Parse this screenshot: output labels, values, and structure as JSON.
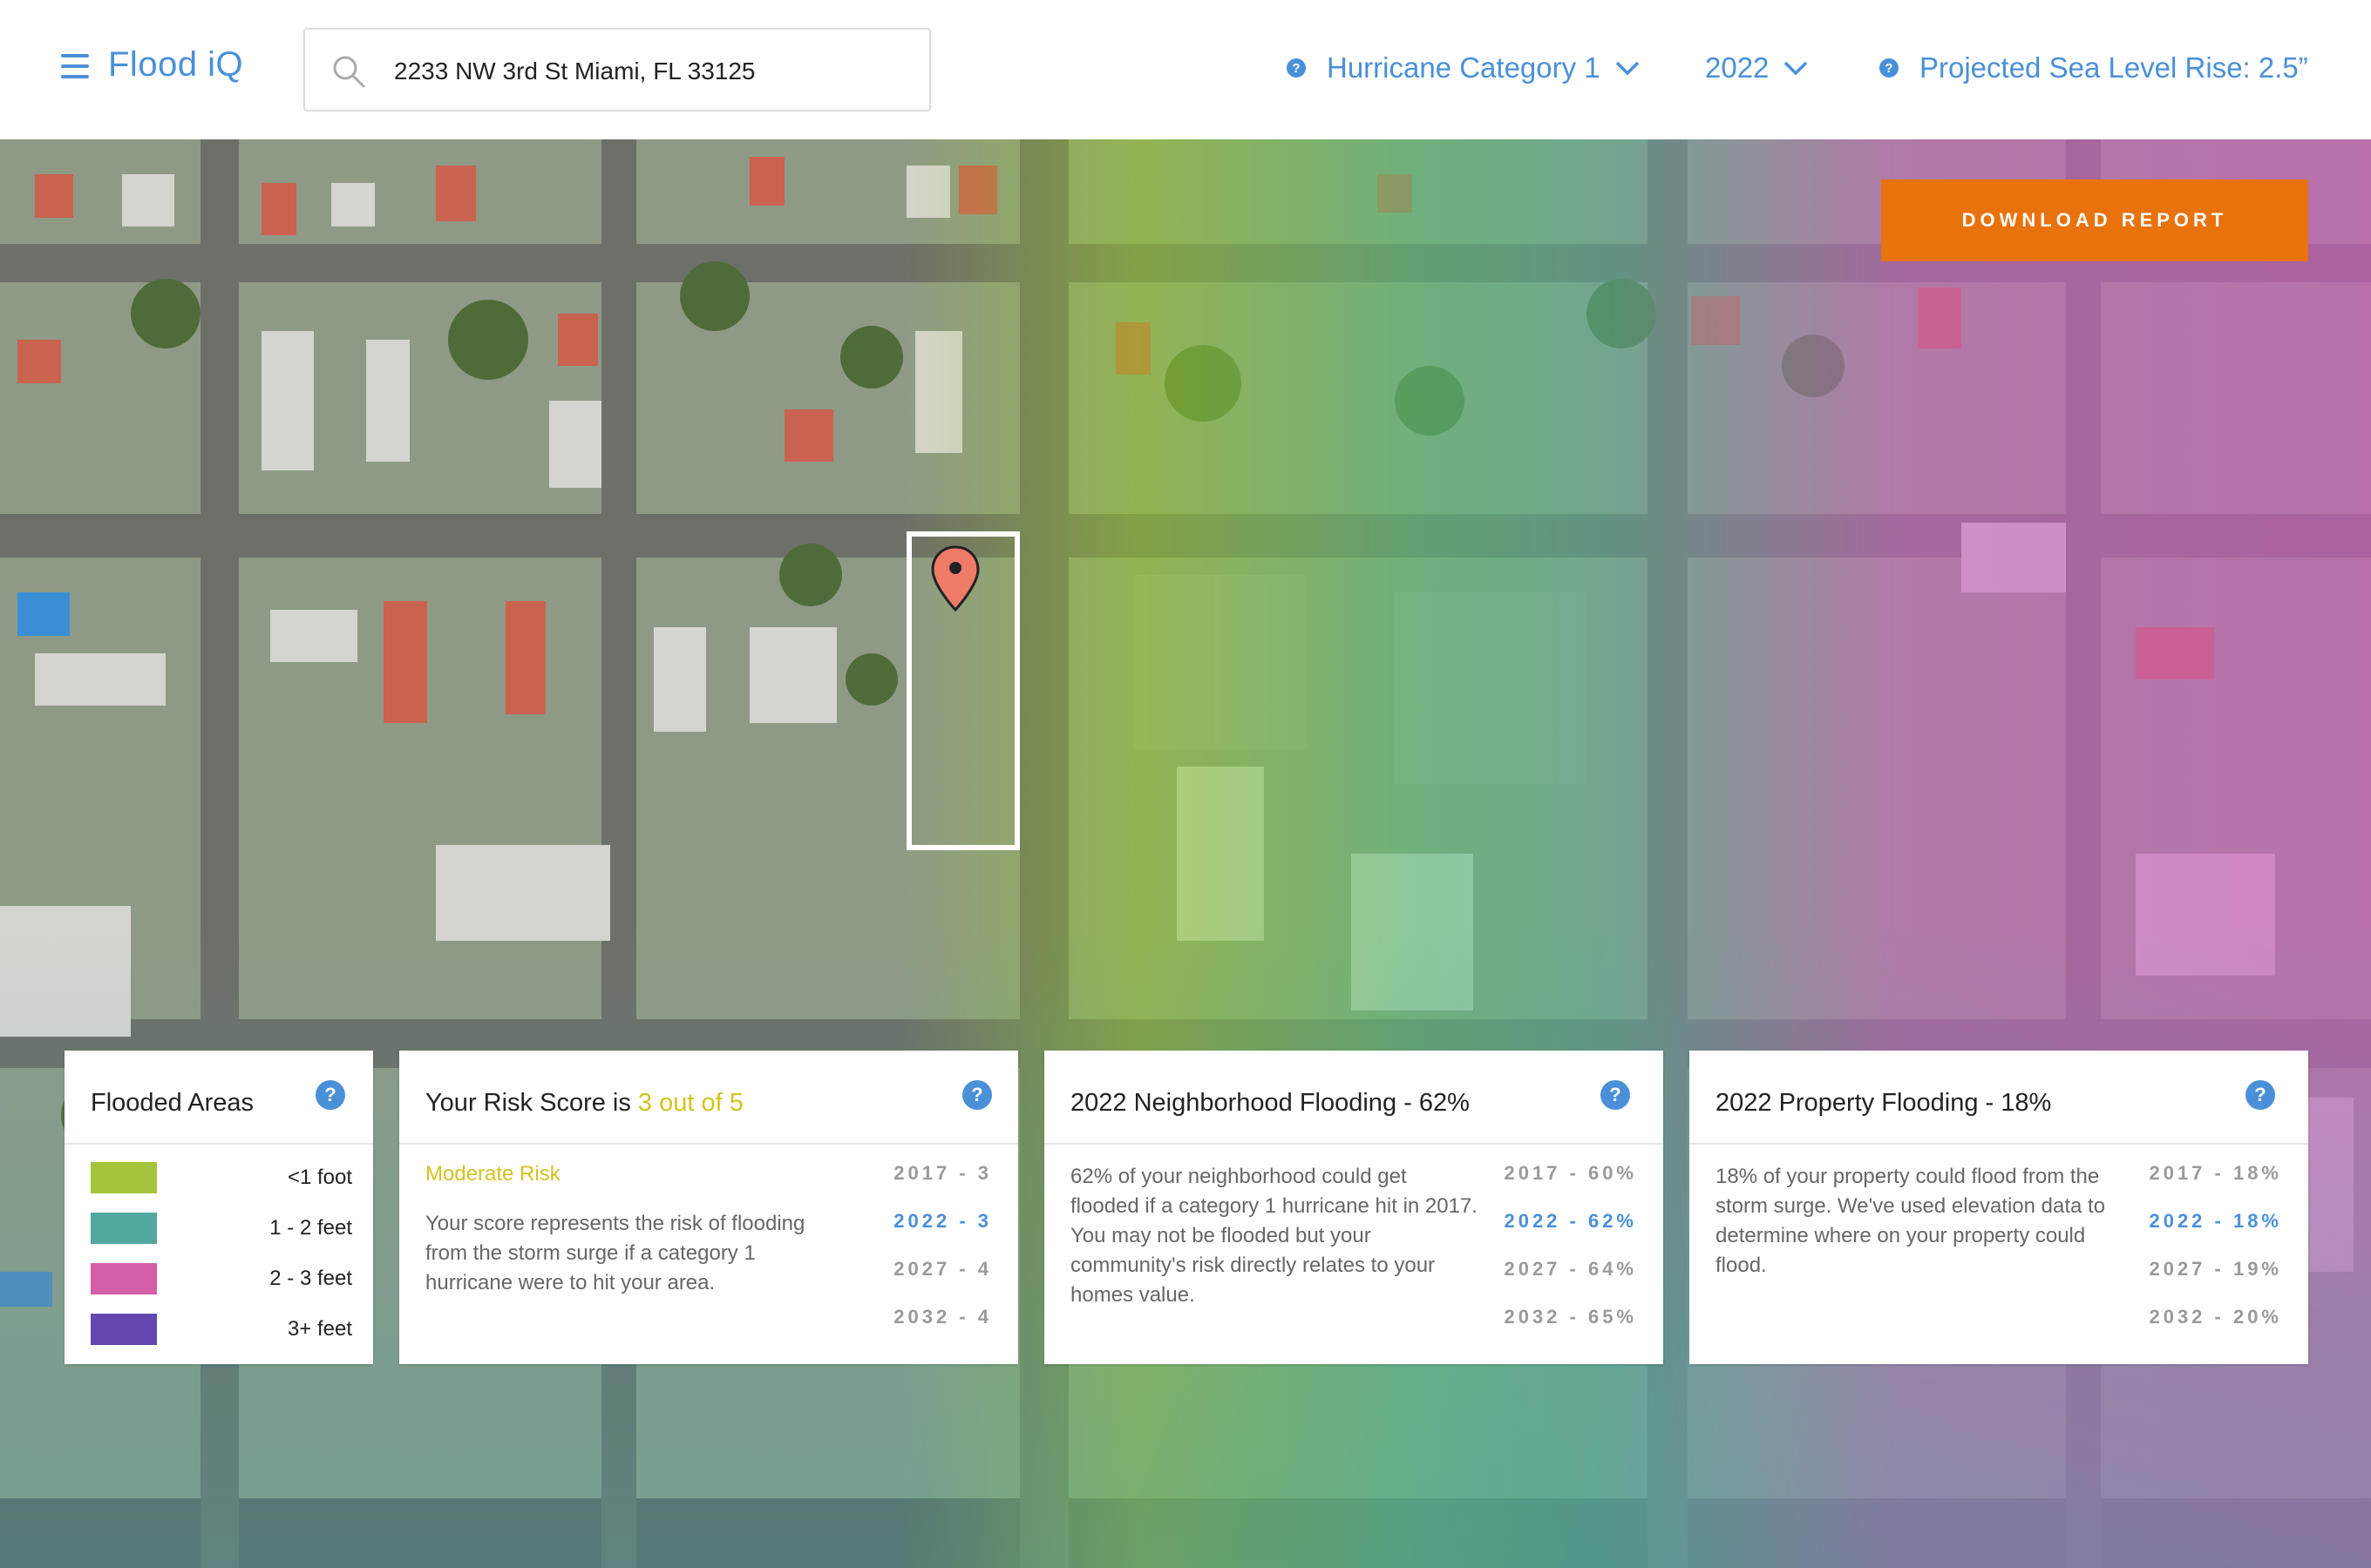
{
  "app": {
    "logo": "Flood iQ"
  },
  "search": {
    "value": "2233 NW 3rd St Miami, FL 33125"
  },
  "controls": {
    "hurricane": "Hurricane Category 1",
    "year": "2022",
    "sea_level": "Projected Sea Level Rise: 2.5”"
  },
  "map": {
    "download_label": "DOWNLOAD REPORT",
    "zoom_in": "+",
    "zoom_out": "–"
  },
  "legend": {
    "title": "Flooded Areas",
    "help": "?",
    "items": [
      {
        "label": "<1 foot",
        "color": "#a6c43b"
      },
      {
        "label": "1 - 2 feet",
        "color": "#52a79e"
      },
      {
        "label": "2 - 3 feet",
        "color": "#d25ea8"
      },
      {
        "label": "3+ feet",
        "color": "#6147ae"
      }
    ]
  },
  "risk_card": {
    "title_prefix": "Your Risk Score is",
    "title_highlight": "3 out of 5",
    "help": "?",
    "risk_label": "Moderate Risk",
    "description": "Your score represents the risk of flooding from the storm surge if a category 1 hurricane were to hit your area.",
    "years": [
      "2017 - 3",
      "2022 - 3",
      "2027 - 4",
      "2032 - 4"
    ]
  },
  "neighborhood_card": {
    "title": "2022 Neighborhood Flooding - 62%",
    "help": "?",
    "description": "62% of your neighborhood could get flooded if a category 1 hurricane hit in 2017. You may not be flooded but your community's risk directly relates to your homes value.",
    "years": [
      "2017 - 60%",
      "2022 - 62%",
      "2027 - 64%",
      "2032 - 65%"
    ]
  },
  "property_card": {
    "title": "2022 Property Flooding - 18%",
    "help": "?",
    "description": "18% of your property could flood from the storm surge. We've used elevation data to determine where on your property could flood.",
    "years": [
      "2017 - 18%",
      "2022 - 18%",
      "2027 - 19%",
      "2032 - 20%"
    ]
  }
}
